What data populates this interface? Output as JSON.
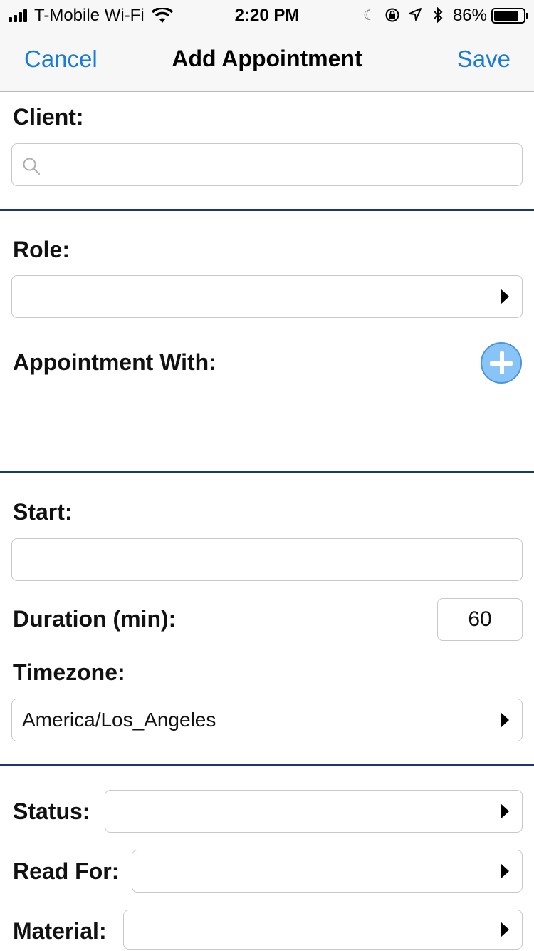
{
  "status_bar": {
    "carrier": "T-Mobile Wi-Fi",
    "time": "2:20 PM",
    "battery_percent": "86%",
    "battery_level": 0.86,
    "icons": [
      "signal-icon",
      "wifi-icon",
      "moon-icon",
      "orientation-lock-icon",
      "location-icon",
      "bluetooth-icon",
      "battery-icon"
    ]
  },
  "nav": {
    "cancel_label": "Cancel",
    "title": "Add Appointment",
    "save_label": "Save"
  },
  "form": {
    "client_label": "Client:",
    "client_value": "",
    "role_label": "Role:",
    "role_value": "",
    "appointment_with_label": "Appointment With:",
    "start_label": "Start:",
    "start_value": "",
    "duration_label": "Duration (min):",
    "duration_value": "60",
    "timezone_label": "Timezone:",
    "timezone_value": "America/Los_Angeles",
    "status_label": "Status:",
    "status_value": "",
    "read_for_label": "Read For:",
    "read_for_value": "",
    "material_label": "Material:",
    "material_value": ""
  },
  "colors": {
    "accent": "#1a7bd8",
    "divider": "#1d3570",
    "add_button": "#88c4f8"
  }
}
